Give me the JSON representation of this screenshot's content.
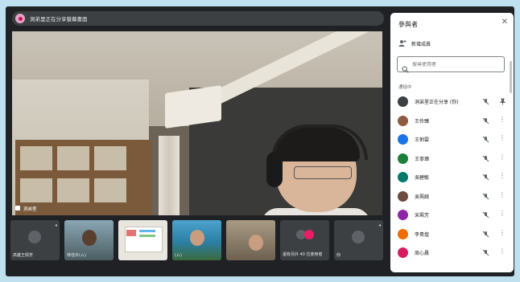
{
  "meeting": {
    "presenter_bar": "洞弟里正在分享螢幕畫面",
    "main_name": "洞弟里"
  },
  "filmstrip": [
    {
      "kind": "avatar",
      "caption": "高雄王佩芳"
    },
    {
      "kind": "cam1",
      "caption": "林佳卉(ㄙ)"
    },
    {
      "kind": "cam2",
      "caption": ""
    },
    {
      "kind": "cam3",
      "caption": "(ㄙ)"
    },
    {
      "kind": "cam4",
      "caption": ""
    },
    {
      "kind": "more",
      "caption": "還有另外 40 位使用者"
    },
    {
      "kind": "avatar",
      "caption": "你"
    }
  ],
  "panel": {
    "title": "參與者",
    "add_label": "新增成員",
    "search_placeholder": "搜尋使用者",
    "section_label": "通話中",
    "participants": [
      {
        "name": "洞弟里正在分享 (你)",
        "color": "#3c4043",
        "initial": "",
        "state": "present"
      },
      {
        "name": "王伶臻",
        "color": "#8e5b3f",
        "initial": "",
        "state": "muted"
      },
      {
        "name": "王俐雲",
        "color": "#1a73e8",
        "initial": "",
        "state": "muted"
      },
      {
        "name": "王寧瑋",
        "color": "#188038",
        "initial": "",
        "state": "muted"
      },
      {
        "name": "吳碧敏",
        "color": "#00796b",
        "initial": "",
        "state": "muted"
      },
      {
        "name": "吳珮綺",
        "color": "#6d4c41",
        "initial": "",
        "state": "muted"
      },
      {
        "name": "宋珮芳",
        "color": "#8e24aa",
        "initial": "",
        "state": "muted"
      },
      {
        "name": "李貴煌",
        "color": "#ef6c00",
        "initial": "",
        "state": "muted"
      },
      {
        "name": "周心晨",
        "color": "#d81b60",
        "initial": "",
        "state": "muted"
      }
    ]
  }
}
